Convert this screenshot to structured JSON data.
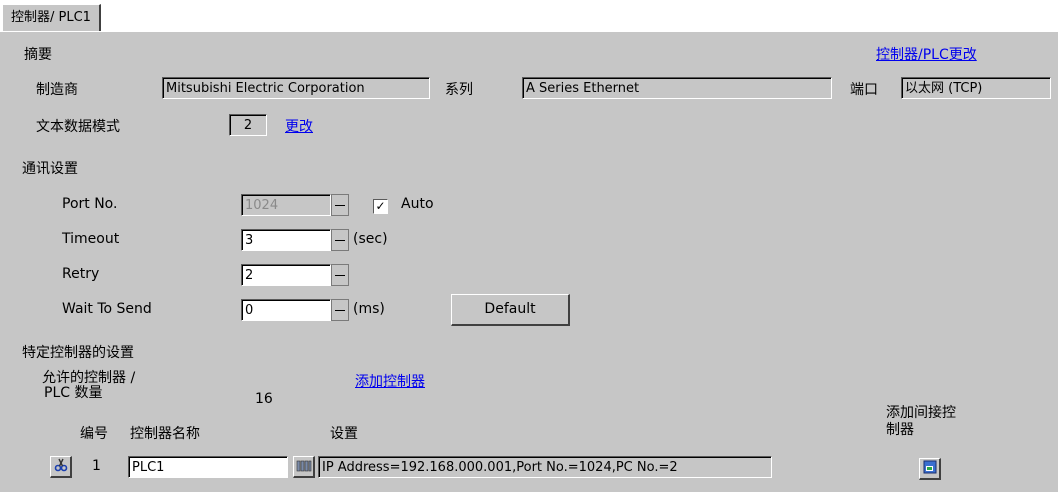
{
  "tab": {
    "label": "控制器/ PLC1"
  },
  "summary": {
    "heading": "摘要",
    "change_link": "控制器/PLC更改",
    "manufacturer_label": "制造商",
    "manufacturer_value": "Mitsubishi Electric Corporation",
    "series_label": "系列",
    "series_value": "A Series Ethernet",
    "port_label": "端口",
    "port_value": "以太网 (TCP)",
    "text_mode_label": "文本数据模式",
    "text_mode_value": "2",
    "text_mode_change": "更改"
  },
  "comm": {
    "heading": "通讯设置",
    "port_label": "Port No.",
    "port_value": "1024",
    "auto_label": "Auto",
    "auto_checked": true,
    "timeout_label": "Timeout",
    "timeout_value": "3",
    "timeout_unit": "(sec)",
    "retry_label": "Retry",
    "retry_value": "2",
    "wait_label": "Wait To Send",
    "wait_value": "0",
    "wait_unit": "(ms)",
    "default_button": "Default"
  },
  "device": {
    "heading": "特定控制器的设置",
    "allowed_label_line1": "允许的控制器 /",
    "allowed_label_line2": "PLC 数量",
    "allowed_count": "16",
    "add_link": "添加控制器",
    "col_number": "编号",
    "col_name": "控制器名称",
    "col_settings": "设置",
    "add_indirect_line1": "添加间接控",
    "add_indirect_line2": "制器",
    "rows": [
      {
        "number": "1",
        "name": "PLC1",
        "settings": "IP Address=192.168.000.001,Port No.=1024,PC No.=2"
      }
    ]
  },
  "icons": {
    "delete": "scissors-icon",
    "settings": "device-settings-icon",
    "add_indirect": "add-indirect-device-icon"
  }
}
